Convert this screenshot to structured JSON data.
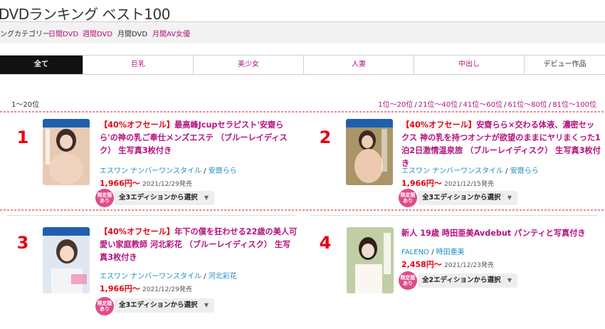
{
  "page": {
    "title": "DVDランキング ベスト100",
    "category_label": "ングカテゴリー",
    "category_links": [
      {
        "label": "日間DVD",
        "current": false
      },
      {
        "label": "週間DVD",
        "current": false
      },
      {
        "label": "月間DVD",
        "current": true
      },
      {
        "label": "月間AV女優",
        "current": false
      }
    ]
  },
  "tabs": [
    "全て",
    "巨乳",
    "美少女",
    "人妻",
    "中出し",
    "デビュー作品"
  ],
  "active_tab": "全て",
  "range_label": "1～20位",
  "pager": [
    "1位～20位",
    "21位～40位",
    "41位～60位",
    "61位～80位",
    "81位～100位"
  ],
  "items": [
    {
      "rank": "1",
      "sale": "【40%オフセール】",
      "title": "最高峰Jcupセラピスト'安齋らら'の神の乳ご奉仕メンズエステ （ブルーレイディスク） 生写真3枚付き",
      "maker": "エスワン ナンバーワンスタイル",
      "actress": "安齋らら",
      "price": "1,966円～",
      "date": "2021/12/29発売",
      "badge": "限定版 あり",
      "edition": "全3エディションから選択"
    },
    {
      "rank": "2",
      "sale": "【40%オフセール】",
      "title": "安齋らら×交わる体液、濃密セックス 神の乳を持つオンナが欲望のままにヤリまくった1泊2日激情温泉旅 （ブルーレイディスク） 生写真3枚付き",
      "maker": "エスワン ナンバーワンスタイル",
      "actress": "安齋らら",
      "price": "1,966円～",
      "date": "2021/12/15発売",
      "badge": "限定版 あり",
      "edition": "全3エディションから選択"
    },
    {
      "rank": "3",
      "sale": "【40%オフセール】",
      "title": "年下の僕を狂わせる22歳の美人可愛い家庭教師 河北彩花 （ブルーレイディスク） 生写真3枚付き",
      "maker": "エスワン ナンバーワンスタイル",
      "actress": "河北彩花",
      "price": "1,966円～",
      "date": "2021/12/29発売",
      "badge": "限定版 あり",
      "edition": "全3エディションから選択"
    },
    {
      "rank": "4",
      "sale": "",
      "title": "新人 19歳 時田亜美Avdebut パンティと写真付き",
      "maker": "FALENO",
      "actress": "時田亜美",
      "price": "2,458円～",
      "date": "2021/12/23発売",
      "badge": "限定版 あり",
      "edition": "全2エディションから選択"
    }
  ],
  "icons": {
    "dropdown": "chevron-down-icon",
    "cover": "cover-image"
  },
  "colors": {
    "accent": "#b5127e",
    "sale": "#e60012",
    "link": "#1a8dc1",
    "badge": "#e14b8a",
    "active_tab": "#111111"
  }
}
